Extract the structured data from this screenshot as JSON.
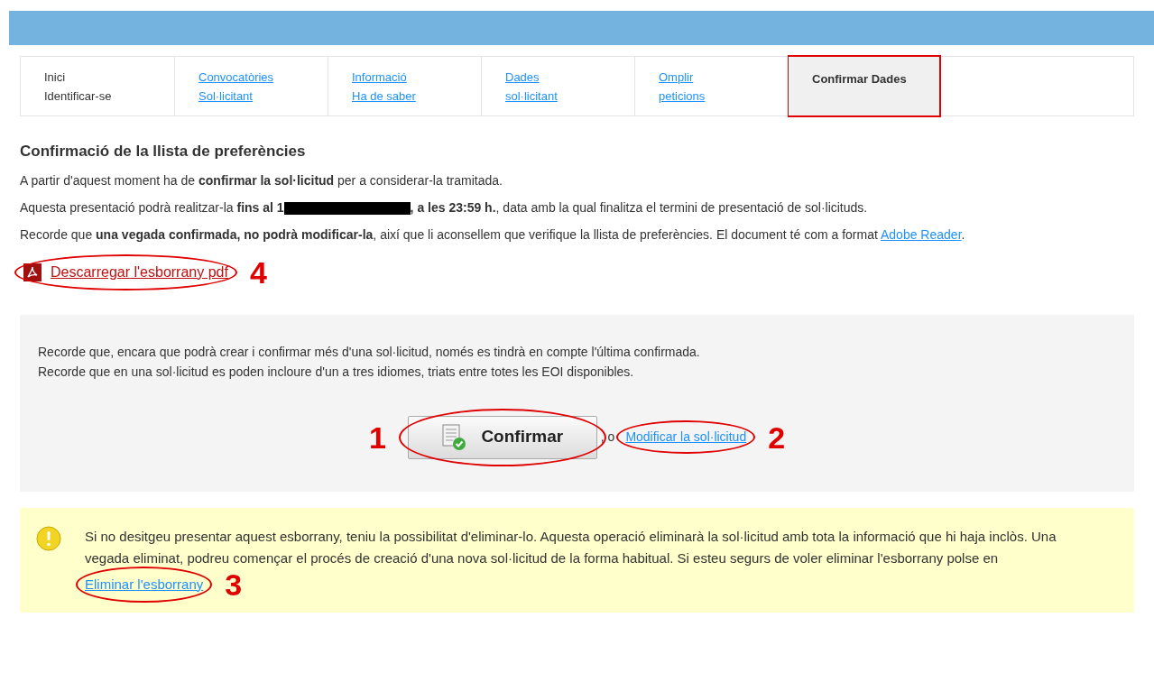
{
  "tabs": [
    {
      "lines": [
        "Inici",
        "Identificar-se"
      ],
      "link": false,
      "selected": false
    },
    {
      "lines": [
        "Convocatòries",
        "Sol·licitant"
      ],
      "link": true,
      "selected": false
    },
    {
      "lines": [
        "Informació",
        "Ha de saber"
      ],
      "link": true,
      "selected": false
    },
    {
      "lines": [
        "Dades",
        "sol·licitant"
      ],
      "link": true,
      "selected": false
    },
    {
      "lines": [
        "Omplir",
        "peticions"
      ],
      "link": true,
      "selected": false
    },
    {
      "lines": [
        "Confirmar Dades"
      ],
      "link": false,
      "selected": true
    }
  ],
  "heading": "Confirmació de la llista de preferències",
  "paragraphs": [
    {
      "text": "A partir d'aquest moment ha de **confirmar la sol·licitud** per a considerar-la tramitada."
    },
    {
      "text": "Aquesta presentació podrà realitzar-la **fins al 1**",
      "redacted": true,
      "after": "**, a les 23:59 h.**, data amb la qual finalitza el termini de presentació de sol·licituds."
    },
    {
      "text": "Recorde que **una vegada confirmada, no podrà modificar-la**, així que li aconsellem que verifique la llista de preferències. El document té com a format",
      "link": "Adobe Reader",
      "after": "."
    }
  ],
  "download": {
    "label": "Descarregar l'esborrany pdf",
    "callout": "4"
  },
  "info_panel": {
    "lines": [
      "Recorde que, encara que podrà crear i confirmar més d'una sol·licitud, només es tindrà en compte l'última confirmada.",
      "Recorde que en una sol·licitud es poden incloure d'un a tres idiomes, triats entre totes les EOI disponibles."
    ],
    "confirm_button": {
      "label": "Confirmar",
      "callout": "1"
    },
    "separator": ", o",
    "modify_link": {
      "label": "Modificar la sol·licitud",
      "callout": "2"
    }
  },
  "warning": {
    "text": "Si no desitgeu presentar aquest esborrany, teniu la possibilitat d'eliminar-lo. Aquesta operació eliminarà la sol·licitud amb tota la informació que hi haja inclòs. Una vegada eliminat, podreu començar el procés de creació d'una nova sol·licitud de la forma habitual. Si esteu segurs de voler eliminar l'esborrany polse en",
    "link": {
      "label": "Eliminar l'esborrany",
      "callout": "3"
    }
  }
}
